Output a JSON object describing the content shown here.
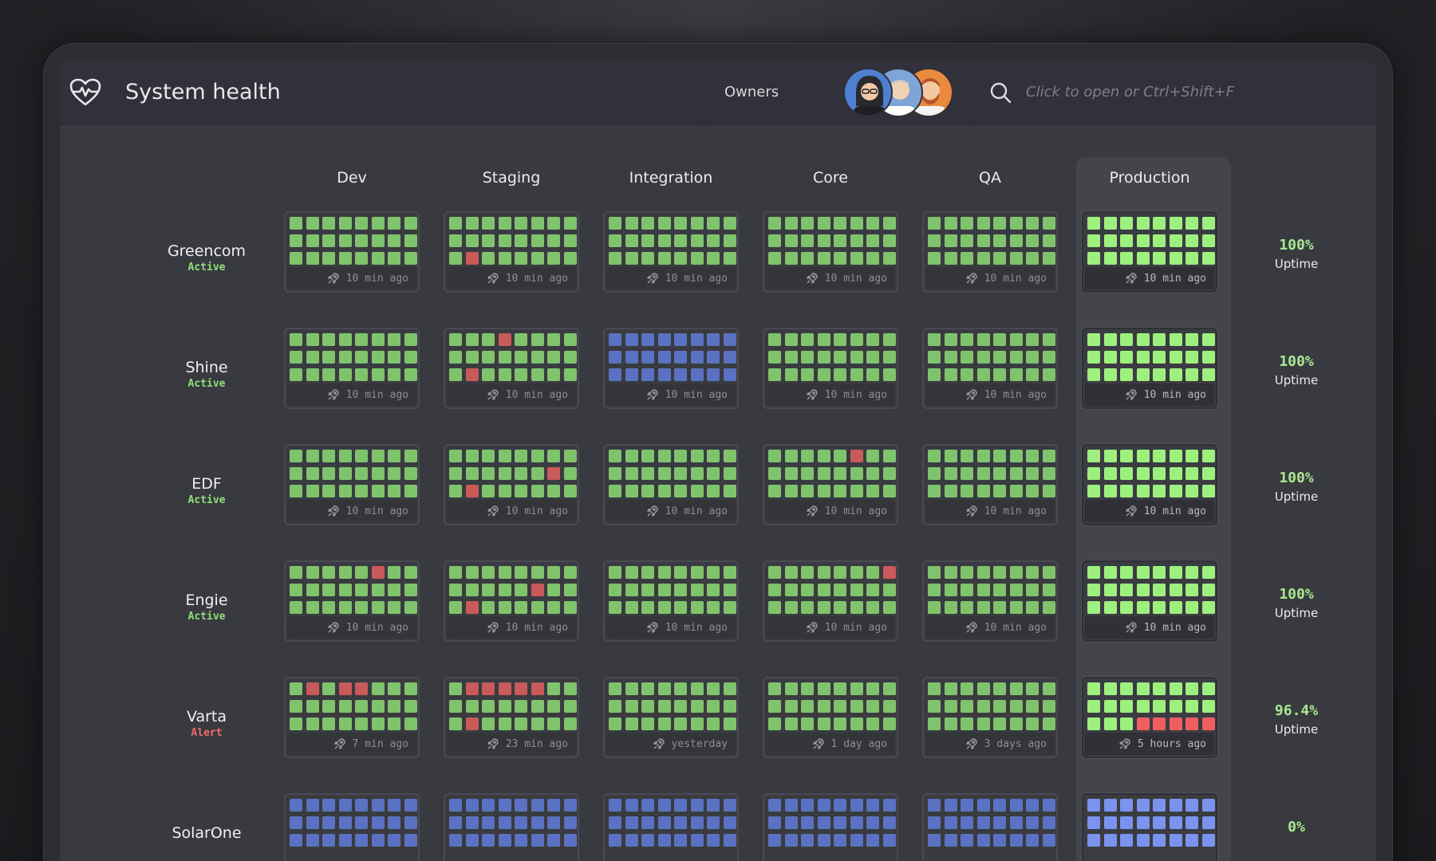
{
  "app": {
    "title": "System health"
  },
  "owners": {
    "label": "Owners"
  },
  "search": {
    "placeholder": "Click to open or Ctrl+Shift+F"
  },
  "colors": {
    "ok": "#7fc46c",
    "ok_prod": "#9ef07e",
    "fail": "#c85a5a",
    "fail_prod": "#ef5f5f",
    "idle": "#5b72c2",
    "idle_prod": "#7b93ee",
    "active": "#8fe07a",
    "alert": "#ef6b6b"
  },
  "columns": [
    "Dev",
    "Staging",
    "Integration",
    "Core",
    "QA",
    "Production"
  ],
  "rows": [
    {
      "name": "Greencom",
      "status": "Active",
      "status_type": "active",
      "uptime": "100%",
      "uptime_label": "Uptime",
      "cards": [
        {
          "last": "10 min ago",
          "fails": []
        },
        {
          "last": "10 min ago",
          "fails": [
            17
          ]
        },
        {
          "last": "10 min ago",
          "fails": []
        },
        {
          "last": "10 min ago",
          "fails": []
        },
        {
          "last": "10 min ago",
          "fails": []
        },
        {
          "last": "10 min ago",
          "fails": []
        }
      ]
    },
    {
      "name": "Shine",
      "status": "Active",
      "status_type": "active",
      "uptime": "100%",
      "uptime_label": "Uptime",
      "cards": [
        {
          "last": "10 min ago",
          "fails": []
        },
        {
          "last": "10 min ago",
          "fails": [
            3,
            17
          ]
        },
        {
          "last": "10 min ago",
          "fails": [],
          "idle": true
        },
        {
          "last": "10 min ago",
          "fails": []
        },
        {
          "last": "10 min ago",
          "fails": []
        },
        {
          "last": "10 min ago",
          "fails": []
        }
      ]
    },
    {
      "name": "EDF",
      "status": "Active",
      "status_type": "active",
      "uptime": "100%",
      "uptime_label": "Uptime",
      "cards": [
        {
          "last": "10 min ago",
          "fails": []
        },
        {
          "last": "10 min ago",
          "fails": [
            14,
            17
          ]
        },
        {
          "last": "10 min ago",
          "fails": []
        },
        {
          "last": "10 min ago",
          "fails": [
            5
          ]
        },
        {
          "last": "10 min ago",
          "fails": []
        },
        {
          "last": "10 min ago",
          "fails": []
        }
      ]
    },
    {
      "name": "Engie",
      "status": "Active",
      "status_type": "active",
      "uptime": "100%",
      "uptime_label": "Uptime",
      "cards": [
        {
          "last": "10 min ago",
          "fails": [
            5
          ]
        },
        {
          "last": "10 min ago",
          "fails": [
            13,
            17
          ]
        },
        {
          "last": "10 min ago",
          "fails": []
        },
        {
          "last": "10 min ago",
          "fails": [
            7
          ]
        },
        {
          "last": "10 min ago",
          "fails": []
        },
        {
          "last": "10 min ago",
          "fails": []
        }
      ]
    },
    {
      "name": "Varta",
      "status": "Alert",
      "status_type": "alert",
      "uptime": "96.4%",
      "uptime_label": "Uptime",
      "cards": [
        {
          "last": "7 min ago",
          "fails": [
            1,
            3,
            4
          ]
        },
        {
          "last": "23 min ago",
          "fails": [
            1,
            2,
            3,
            4,
            5,
            17
          ]
        },
        {
          "last": "yesterday",
          "fails": []
        },
        {
          "last": "1 day ago",
          "fails": []
        },
        {
          "last": "3 days ago",
          "fails": []
        },
        {
          "last": "5 hours ago",
          "fails": [
            19,
            20,
            21,
            22,
            23
          ]
        }
      ]
    },
    {
      "name": "SolarOne",
      "status": "",
      "status_type": "active",
      "uptime": "0%",
      "uptime_label": "",
      "cards": [
        {
          "last": "",
          "fails": [],
          "idle": true
        },
        {
          "last": "",
          "fails": [],
          "idle": true
        },
        {
          "last": "",
          "fails": [],
          "idle": true
        },
        {
          "last": "",
          "fails": [],
          "idle": true
        },
        {
          "last": "",
          "fails": [],
          "idle": true
        },
        {
          "last": "",
          "fails": [],
          "idle": true
        }
      ]
    }
  ]
}
